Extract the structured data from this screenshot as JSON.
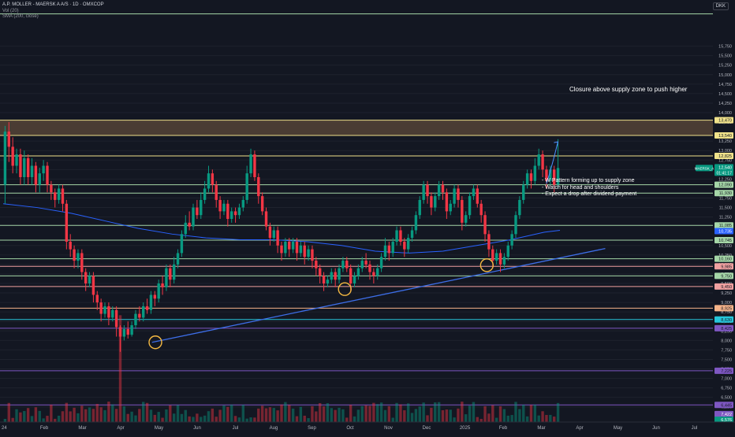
{
  "legend": {
    "title": "A.P. MOLLER - MAERSK A A/S · 1D · OMXCOP",
    "volume_label": "Vol (20)",
    "sma_label": "SMA (200, close)"
  },
  "currency": "DKK",
  "annotations": {
    "title": "Closure above supply zone to push higher",
    "notes": [
      "- W Pattern forming up to supply zone",
      "- Watch for head and shoulders",
      "- Expect a drop after dividend payment"
    ]
  },
  "colors": {
    "background": "#131722",
    "up": "#089981",
    "down": "#f23645",
    "sma": "#2962ff",
    "trendline": "#3d6ee8",
    "supply_zone": "#5d4a3a",
    "supply_border": "#e8d27a",
    "level_yellow": "#f0e28a",
    "level_green": "#a5d6a7",
    "level_pink": "#f0a0a0",
    "level_orange": "#f5b389",
    "level_teal": "#26c6da",
    "level_purple": "#7e57c2",
    "circle": "#f5b942"
  },
  "chart_data": {
    "type": "candlestick",
    "symbol": "MAERSK_A",
    "ylim": [
      5850,
      16800
    ],
    "price_ticks": [
      15750,
      15500,
      15250,
      15000,
      14750,
      14500,
      14250,
      14000,
      13750,
      13250,
      13000,
      12750,
      12500,
      12250,
      11750,
      11500,
      11250,
      10500,
      10250,
      10000,
      9750,
      9500,
      9250,
      9000,
      8750,
      8500,
      8250,
      8000,
      7750,
      7500,
      7250,
      7000,
      6750,
      6500,
      6250
    ],
    "x_months": [
      "Feb",
      "Mar",
      "Apr",
      "May",
      "Jun",
      "Jul",
      "Aug",
      "Sep",
      "Oct",
      "Nov",
      "Dec",
      "2025",
      "Feb",
      "Mar",
      "Apr",
      "May",
      "Jun",
      "Jul"
    ],
    "x_first_label": "24",
    "last_price": {
      "value": "12,540",
      "label": "MAERSK_A",
      "countdown": "01:41:17",
      "price": 12540
    },
    "supply_zone": [
      13400,
      13800
    ],
    "levels": [
      {
        "price": 16600,
        "label": null,
        "color": "level_green"
      },
      {
        "price": 13800,
        "label": "13,470",
        "color": "level_yellow"
      },
      {
        "price": 13400,
        "label": "13,540",
        "color": "level_yellow"
      },
      {
        "price": 12860,
        "label": "12,825",
        "color": "level_yellow"
      },
      {
        "price": 12100,
        "label": "12,090",
        "color": "level_green"
      },
      {
        "price": 11880,
        "label": "11,930",
        "color": "level_green"
      },
      {
        "price": 11030,
        "label": "11,085",
        "color": "level_green"
      },
      {
        "price": 10640,
        "label": "10,745",
        "color": "level_green"
      },
      {
        "price": 10150,
        "label": "10,160",
        "color": "level_green"
      },
      {
        "price": 9950,
        "label": "9,985",
        "color": "level_pink"
      },
      {
        "price": 9700,
        "label": "9,750",
        "color": "level_green"
      },
      {
        "price": 9420,
        "label": "9,450",
        "color": "level_pink"
      },
      {
        "price": 8850,
        "label": "8,925",
        "color": "level_orange"
      },
      {
        "price": 8550,
        "label": "8,630",
        "color": "level_teal"
      },
      {
        "price": 8320,
        "label": "8,425",
        "color": "level_purple"
      },
      {
        "price": 7200,
        "label": "7,225",
        "color": "level_purple"
      },
      {
        "price": 6300,
        "label": "6,445",
        "color": "level_purple"
      }
    ],
    "extra_price_tags": [
      {
        "price": 10880,
        "value": "10,735",
        "color": "#2962ff"
      },
      {
        "price": 6060,
        "value": "7,422",
        "color": "#7e57c2"
      },
      {
        "price": 5910,
        "value": "6,576",
        "color": "#089981"
      }
    ],
    "trendline": {
      "start": [
        0.22,
        7950
      ],
      "end": [
        0.89,
        10420
      ]
    },
    "circles": [
      {
        "t": 0.225,
        "price": 7950
      },
      {
        "t": 0.505,
        "price": 9350
      },
      {
        "t": 0.715,
        "price": 9980
      }
    ],
    "arrow": {
      "from": [
        0.81,
        12500
      ],
      "to": [
        0.82,
        13230
      ]
    },
    "candles": [
      [
        12100,
        13500,
        11600,
        13650
      ],
      [
        13500,
        13100,
        12700,
        13750
      ],
      [
        13100,
        12600,
        12400,
        13350
      ],
      [
        12600,
        12900,
        12400,
        13050
      ],
      [
        12900,
        12300,
        12100,
        13050
      ],
      [
        12300,
        12800,
        12100,
        13000
      ],
      [
        12800,
        12300,
        12100,
        12900
      ],
      [
        12300,
        12600,
        12100,
        12800
      ],
      [
        12600,
        12100,
        11900,
        12700
      ],
      [
        12100,
        12400,
        11900,
        12550
      ],
      [
        12400,
        12600,
        12200,
        12750
      ],
      [
        12600,
        12100,
        11900,
        12700
      ],
      [
        12100,
        11900,
        11700,
        12200
      ],
      [
        11900,
        11700,
        11500,
        12000
      ],
      [
        11700,
        12000,
        11600,
        12100
      ],
      [
        12000,
        11600,
        11400,
        12100
      ],
      [
        11600,
        10600,
        10400,
        11700
      ],
      [
        10600,
        10400,
        10200,
        10800
      ],
      [
        10400,
        10100,
        9900,
        10500
      ],
      [
        10100,
        10300,
        9900,
        10400
      ],
      [
        10300,
        9800,
        9600,
        10400
      ],
      [
        9800,
        9500,
        9300,
        9900
      ],
      [
        9500,
        9700,
        9400,
        9800
      ],
      [
        9700,
        9200,
        9000,
        9800
      ],
      [
        9200,
        9000,
        8800,
        9300
      ],
      [
        9000,
        8700,
        8500,
        9100
      ],
      [
        8700,
        8900,
        8600,
        9000
      ],
      [
        8900,
        8600,
        8400,
        9000
      ],
      [
        8600,
        8800,
        8500,
        8900
      ],
      [
        8800,
        8350,
        8100,
        8900
      ],
      [
        8350,
        8100,
        7700,
        8400
      ],
      [
        8100,
        8300,
        8000,
        8400
      ],
      [
        8300,
        8150,
        8050,
        8500
      ],
      [
        8150,
        8400,
        8100,
        8500
      ],
      [
        8400,
        8700,
        8300,
        8800
      ],
      [
        8700,
        8600,
        8500,
        8900
      ],
      [
        8600,
        8900,
        8500,
        9000
      ],
      [
        8900,
        8800,
        8700,
        9100
      ],
      [
        8800,
        9200,
        8700,
        9300
      ],
      [
        9200,
        9100,
        8900,
        9300
      ],
      [
        9100,
        9500,
        9000,
        9600
      ],
      [
        9500,
        9400,
        9200,
        9700
      ],
      [
        9400,
        9900,
        9300,
        10000
      ],
      [
        9900,
        9600,
        9400,
        10000
      ],
      [
        9600,
        10000,
        9500,
        10200
      ],
      [
        10000,
        10300,
        9900,
        10400
      ],
      [
        10300,
        10800,
        10200,
        10900
      ],
      [
        10800,
        11100,
        10700,
        11300
      ],
      [
        11100,
        11000,
        10900,
        11400
      ],
      [
        11000,
        11500,
        10900,
        11600
      ],
      [
        11500,
        11300,
        11200,
        11700
      ],
      [
        11300,
        11700,
        11200,
        11900
      ],
      [
        11700,
        12000,
        11600,
        12200
      ],
      [
        12000,
        12400,
        11900,
        12600
      ],
      [
        12400,
        12100,
        11900,
        12500
      ],
      [
        12100,
        11700,
        11500,
        12200
      ],
      [
        11700,
        11400,
        11200,
        11800
      ],
      [
        11400,
        11600,
        11300,
        11700
      ],
      [
        11600,
        11200,
        11000,
        11700
      ],
      [
        11200,
        11400,
        11100,
        11500
      ],
      [
        11400,
        11300,
        11100,
        11500
      ],
      [
        11300,
        11500,
        11200,
        11600
      ],
      [
        11500,
        11700,
        11400,
        11800
      ],
      [
        11700,
        12400,
        11600,
        12600
      ],
      [
        12400,
        12900,
        12300,
        13050
      ],
      [
        12900,
        12300,
        12200,
        13000
      ],
      [
        12300,
        11800,
        11600,
        12400
      ],
      [
        11800,
        11400,
        11300,
        11900
      ],
      [
        11400,
        11000,
        10900,
        11500
      ],
      [
        11000,
        10700,
        10500,
        11100
      ],
      [
        10700,
        10900,
        10600,
        11000
      ],
      [
        10900,
        10500,
        10300,
        11000
      ],
      [
        10500,
        10300,
        10100,
        10600
      ],
      [
        10300,
        10600,
        10200,
        10700
      ],
      [
        10600,
        10400,
        10200,
        10700
      ],
      [
        10400,
        10600,
        10300,
        10700
      ],
      [
        10600,
        10300,
        10100,
        10700
      ],
      [
        10300,
        10500,
        10200,
        10600
      ],
      [
        10500,
        10200,
        10000,
        10600
      ],
      [
        10200,
        10400,
        10100,
        10500
      ],
      [
        10400,
        10100,
        9900,
        10500
      ],
      [
        10100,
        9900,
        9700,
        10200
      ],
      [
        9900,
        9700,
        9500,
        10000
      ],
      [
        9700,
        9500,
        9300,
        9800
      ],
      [
        9500,
        9600,
        9400,
        9700
      ],
      [
        9600,
        9800,
        9500,
        9900
      ],
      [
        9800,
        9600,
        9400,
        9900
      ],
      [
        9600,
        9900,
        9500,
        10000
      ],
      [
        9900,
        10100,
        9800,
        10200
      ],
      [
        10100,
        9900,
        9800,
        10200
      ],
      [
        9900,
        9500,
        9300,
        10000
      ],
      [
        9500,
        9700,
        9400,
        9800
      ],
      [
        9700,
        9900,
        9600,
        10000
      ],
      [
        9900,
        10100,
        9800,
        10200
      ],
      [
        10100,
        10000,
        9900,
        10300
      ],
      [
        10000,
        9800,
        9600,
        10100
      ],
      [
        9800,
        9700,
        9500,
        9900
      ],
      [
        9700,
        9900,
        9600,
        10000
      ],
      [
        9900,
        10200,
        9800,
        10300
      ],
      [
        10200,
        10500,
        10100,
        10700
      ],
      [
        10500,
        10300,
        10100,
        10600
      ],
      [
        10300,
        10600,
        10200,
        10700
      ],
      [
        10600,
        10900,
        10500,
        11000
      ],
      [
        10900,
        10600,
        10500,
        11000
      ],
      [
        10600,
        10400,
        10200,
        10700
      ],
      [
        10400,
        10700,
        10300,
        10800
      ],
      [
        10700,
        10900,
        10600,
        11000
      ],
      [
        10900,
        11300,
        10800,
        11400
      ],
      [
        11300,
        11700,
        11200,
        11800
      ],
      [
        11700,
        12100,
        11600,
        12200
      ],
      [
        12100,
        11800,
        11600,
        12200
      ],
      [
        11800,
        11500,
        11300,
        11900
      ],
      [
        11500,
        11800,
        11400,
        11900
      ],
      [
        11800,
        12100,
        11700,
        12200
      ],
      [
        12100,
        11900,
        11700,
        12200
      ],
      [
        11900,
        11400,
        11200,
        12000
      ],
      [
        11400,
        11600,
        11300,
        11700
      ],
      [
        11600,
        12000,
        11500,
        12100
      ],
      [
        12000,
        11700,
        11500,
        12100
      ],
      [
        11700,
        11100,
        10900,
        11800
      ],
      [
        11100,
        11300,
        11000,
        11400
      ],
      [
        11300,
        11800,
        11200,
        11900
      ],
      [
        11800,
        12000,
        11700,
        12100
      ],
      [
        12000,
        11600,
        11500,
        12100
      ],
      [
        11600,
        11300,
        11100,
        11700
      ],
      [
        11300,
        10800,
        10600,
        11400
      ],
      [
        10800,
        10400,
        10200,
        10900
      ],
      [
        10400,
        10100,
        9900,
        10500
      ],
      [
        10100,
        10300,
        10000,
        10400
      ],
      [
        10300,
        10000,
        9800,
        10400
      ],
      [
        10000,
        10200,
        9900,
        10300
      ],
      [
        10200,
        10500,
        10100,
        10600
      ],
      [
        10500,
        10800,
        10400,
        10900
      ],
      [
        10800,
        11300,
        10700,
        11400
      ],
      [
        11300,
        11700,
        11200,
        11800
      ],
      [
        11700,
        12100,
        11600,
        12200
      ],
      [
        12100,
        12400,
        12000,
        12500
      ],
      [
        12400,
        12200,
        12000,
        12500
      ],
      [
        12200,
        12600,
        12100,
        12800
      ],
      [
        12600,
        12900,
        12500,
        13050
      ],
      [
        12900,
        12500,
        12300,
        13000
      ],
      [
        12500,
        12200,
        12000,
        12600
      ],
      [
        12200,
        12500,
        12100,
        12600
      ],
      [
        12500,
        12100,
        11900,
        12600
      ],
      [
        12100,
        12540,
        12000,
        13300
      ]
    ],
    "sma": [
      [
        0.0,
        11600
      ],
      [
        0.05,
        11500
      ],
      [
        0.1,
        11350
      ],
      [
        0.15,
        11150
      ],
      [
        0.2,
        10950
      ],
      [
        0.25,
        10800
      ],
      [
        0.3,
        10700
      ],
      [
        0.35,
        10650
      ],
      [
        0.4,
        10650
      ],
      [
        0.45,
        10600
      ],
      [
        0.5,
        10500
      ],
      [
        0.55,
        10350
      ],
      [
        0.6,
        10300
      ],
      [
        0.65,
        10350
      ],
      [
        0.7,
        10500
      ],
      [
        0.75,
        10650
      ],
      [
        0.8,
        10850
      ],
      [
        0.823,
        10900
      ]
    ]
  }
}
